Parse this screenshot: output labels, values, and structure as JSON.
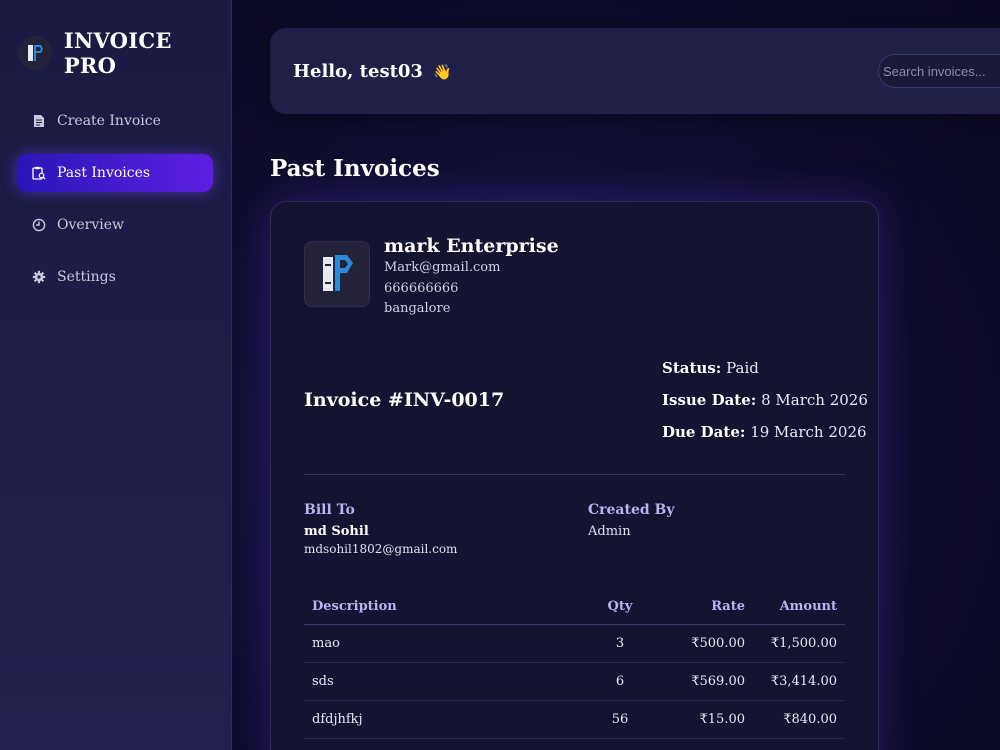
{
  "brand": {
    "title": "INVOICE PRO",
    "logo_icon": "ip-logo-icon"
  },
  "sidebar": {
    "items": [
      {
        "label": "Create Invoice",
        "icon": "document-icon",
        "active": false
      },
      {
        "label": "Past Invoices",
        "icon": "clipboard-search-icon",
        "active": true
      },
      {
        "label": "Overview",
        "icon": "clock-icon",
        "active": false
      },
      {
        "label": "Settings",
        "icon": "gear-icon",
        "active": false
      }
    ]
  },
  "header": {
    "greeting": "Hello, test03",
    "wave_emoji": "👋",
    "search_placeholder": "Search invoices..."
  },
  "page": {
    "title": "Past Invoices"
  },
  "invoice": {
    "business": {
      "name": "mark Enterprise",
      "email": "Mark@gmail.com",
      "phone": "666666666",
      "city": "bangalore"
    },
    "number": "Invoice #INV-0017",
    "status_label": "Status:",
    "status": "Paid",
    "issue_label": "Issue Date:",
    "issue_date": "8 March 2026",
    "due_label": "Due Date:",
    "due_date": "19 March 2026",
    "bill_to_label": "Bill To",
    "bill_to_name": "md Sohil",
    "bill_to_email": "mdsohil1802@gmail.com",
    "created_by_label": "Created By",
    "created_by": "Admin",
    "columns": {
      "description": "Description",
      "qty": "Qty",
      "rate": "Rate",
      "amount": "Amount"
    },
    "items": [
      {
        "description": "mao",
        "qty": "3",
        "rate": "₹500.00",
        "amount": "₹1,500.00"
      },
      {
        "description": "sds",
        "qty": "6",
        "rate": "₹569.00",
        "amount": "₹3,414.00"
      },
      {
        "description": "dfdjhfkj",
        "qty": "56",
        "rate": "₹15.00",
        "amount": "₹840.00"
      }
    ]
  },
  "colors": {
    "accent": "#5b1fe0",
    "label": "#b7b4f0",
    "card": "#141330"
  }
}
